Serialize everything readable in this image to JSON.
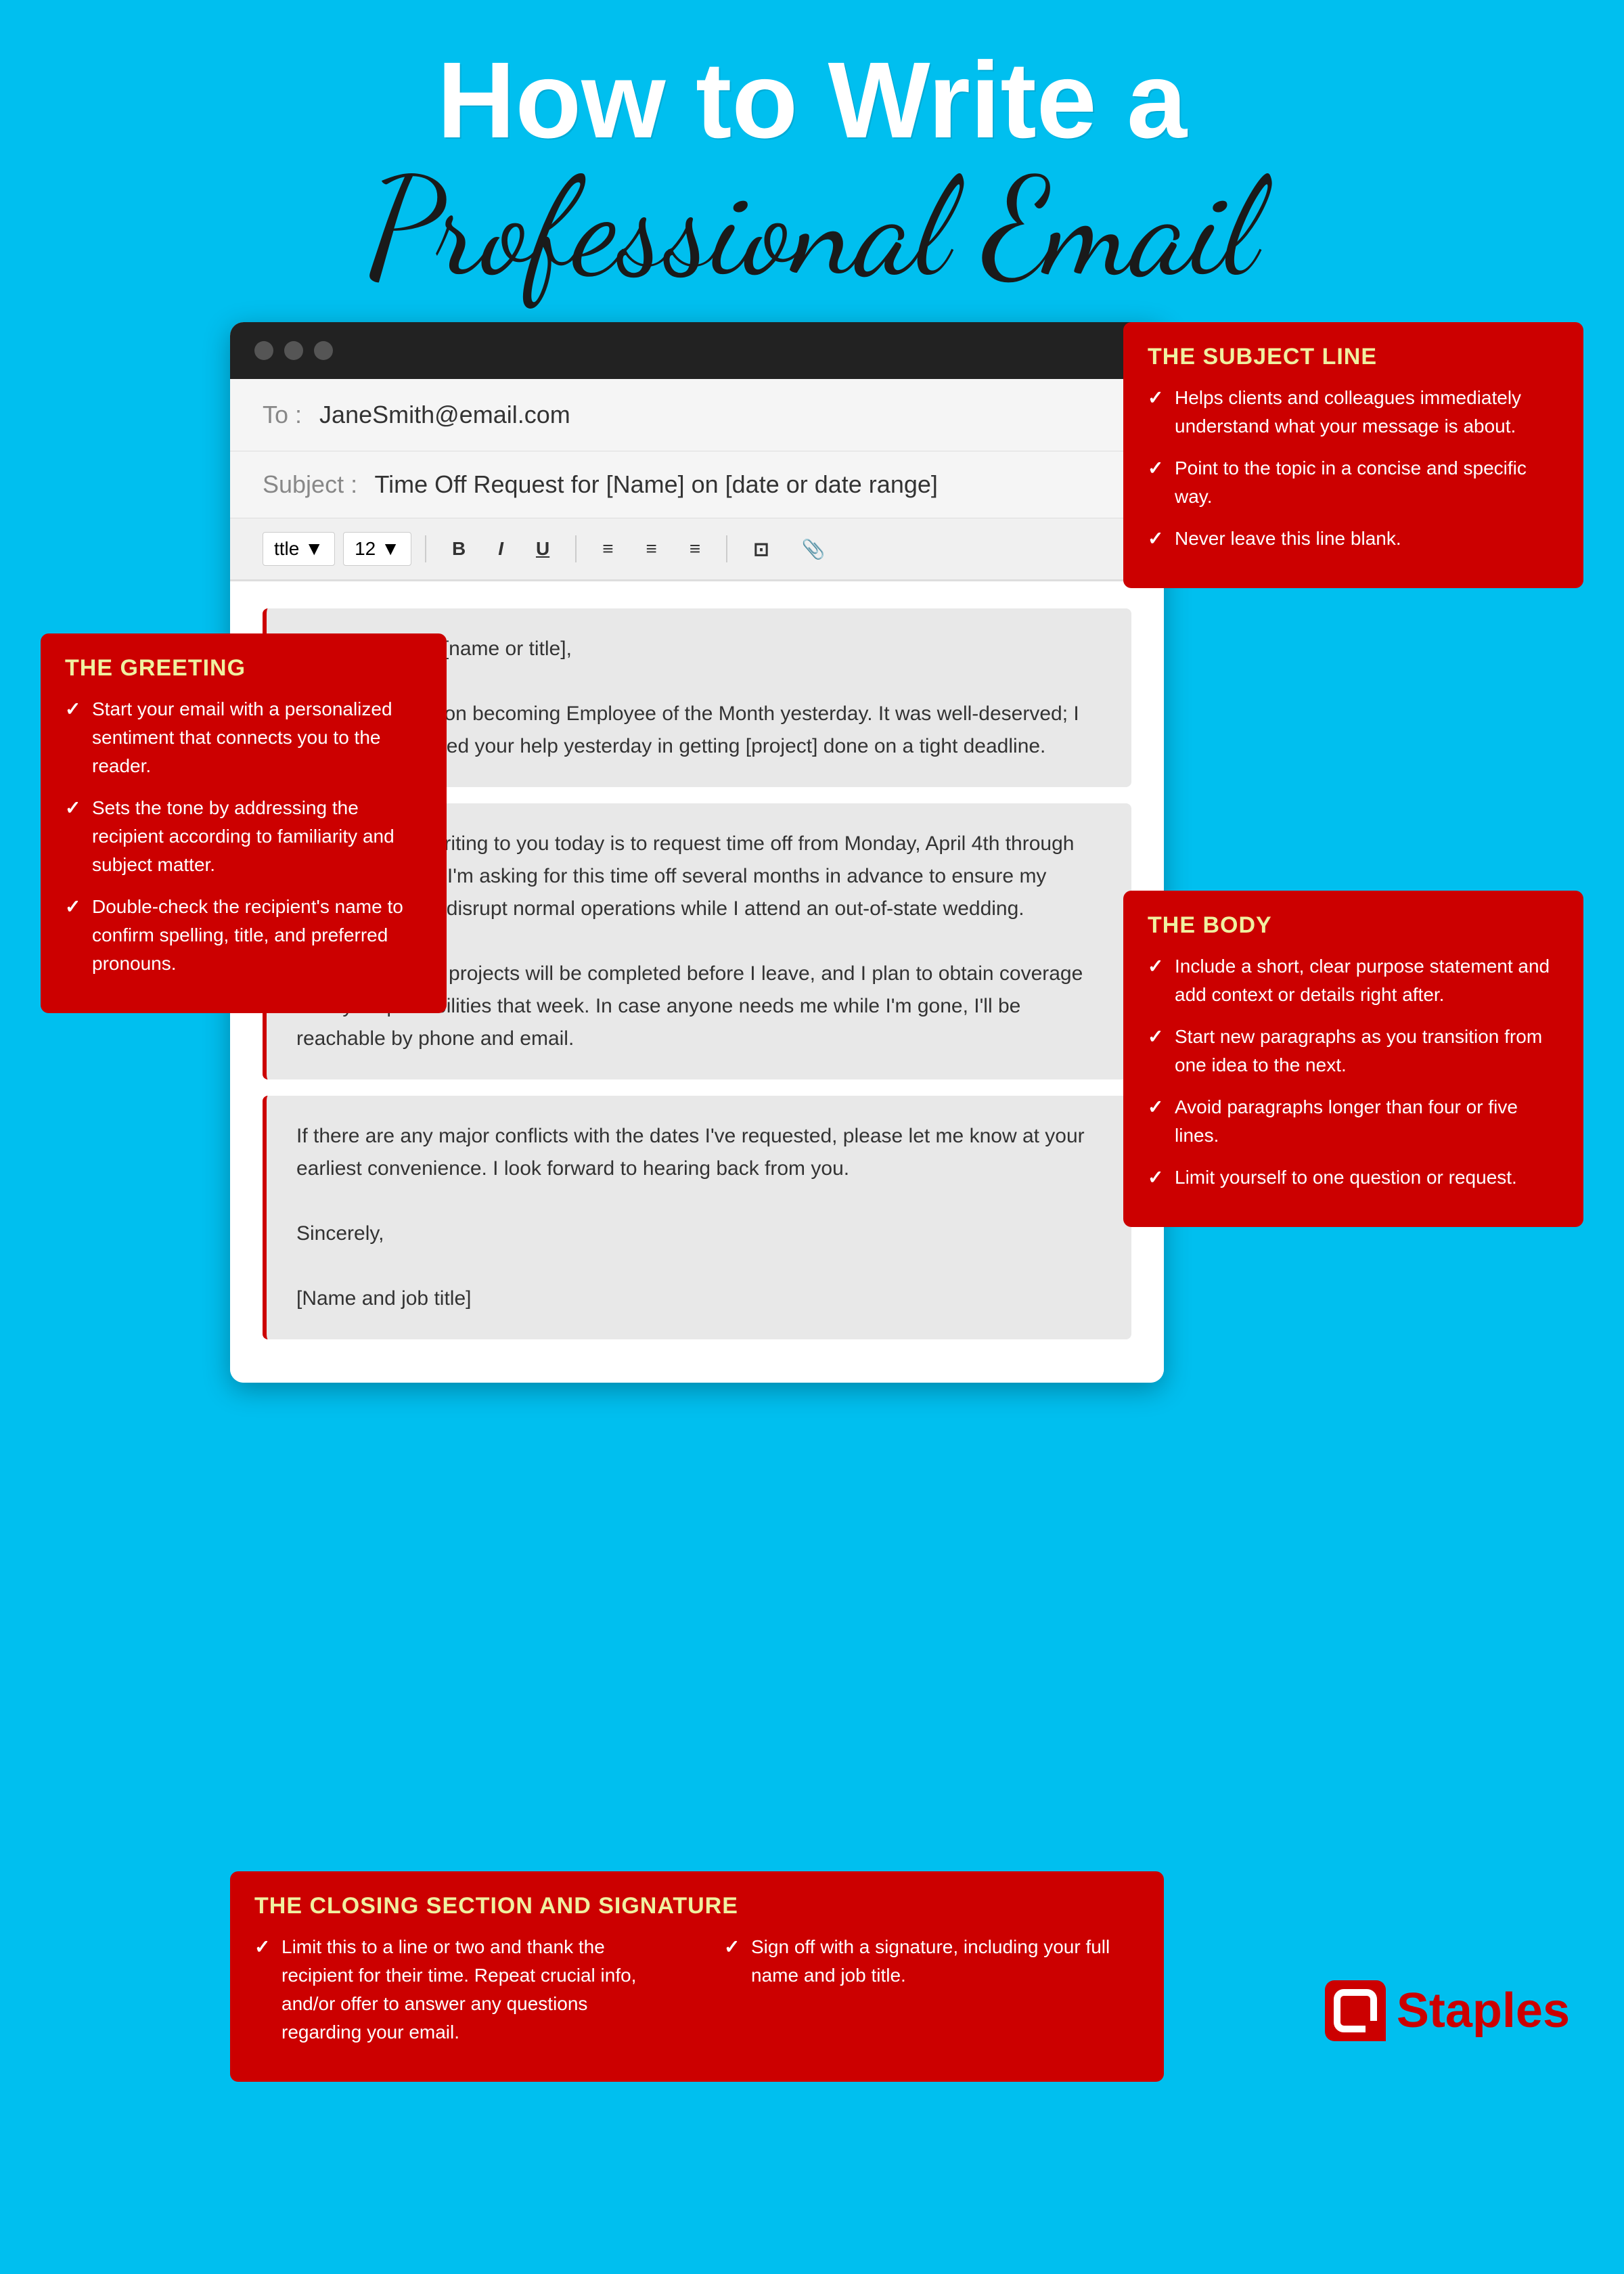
{
  "title": {
    "line1": "How to Write a",
    "line2": "Professional Email"
  },
  "email": {
    "to_label": "To :",
    "to_value": "JaneSmith@email.com",
    "subject_label": "Subject :",
    "subject_value": "Time Off Request for [Name] on [date or date range]",
    "toolbar": {
      "font_placeholder": "ttle",
      "size": "12",
      "bold": "B",
      "italic": "I",
      "underline": "U"
    },
    "paragraphs": {
      "greeting": "Good afternoon [name or title],\n\nCongratulations on becoming Employee of the Month yesterday. It was well-deserved; I greatly appreciated your help yesterday in getting [project] done on a tight deadline.",
      "body": "My purpose in writing to you today is to request time off from Monday, April 4th through Friday, April 8th. I'm asking for this time off several months in advance to ensure my absence will not disrupt normal operations while I attend an out-of-state wedding.\n\nAll of my current projects will be completed before I leave, and I plan to obtain coverage for my responsibilities that week. In case anyone needs me while I'm gone, I'll be reachable by phone and email.",
      "closing": "If there are any major conflicts with the dates I've requested, please let me know at your earliest convenience. I look forward to hearing back from you.\n\nSincerely,\n\n[Name and job title]"
    }
  },
  "annotations": {
    "greeting": {
      "title": "THE GREETING",
      "points": [
        "Start your email with a personalized sentiment that connects you to the reader.",
        "Sets the tone by addressing the recipient according to familiarity and subject matter.",
        "Double-check the recipient's name to confirm spelling, title, and preferred pronouns."
      ]
    },
    "subject_line": {
      "title": "THE SUBJECT LINE",
      "points": [
        "Helps clients and colleagues immediately understand what your message is about.",
        "Point to the topic in a concise and specific way.",
        "Never leave this line blank."
      ]
    },
    "body": {
      "title": "THE BODY",
      "points": [
        "Include a short, clear purpose statement and add context or details right after.",
        "Start new paragraphs as you transition from one idea to the next.",
        "Avoid paragraphs longer than four or five lines.",
        "Limit yourself to one question or request."
      ]
    },
    "closing": {
      "title": "THE CLOSING SECTION AND SIGNATURE",
      "col1_points": [
        "Limit this to a line or two and thank the recipient for their time. Repeat crucial info, and/or offer to answer any questions regarding your email."
      ],
      "col2_points": [
        "Sign off with a signature, including your full name and job title."
      ]
    }
  },
  "staples": {
    "name": "Staples"
  }
}
